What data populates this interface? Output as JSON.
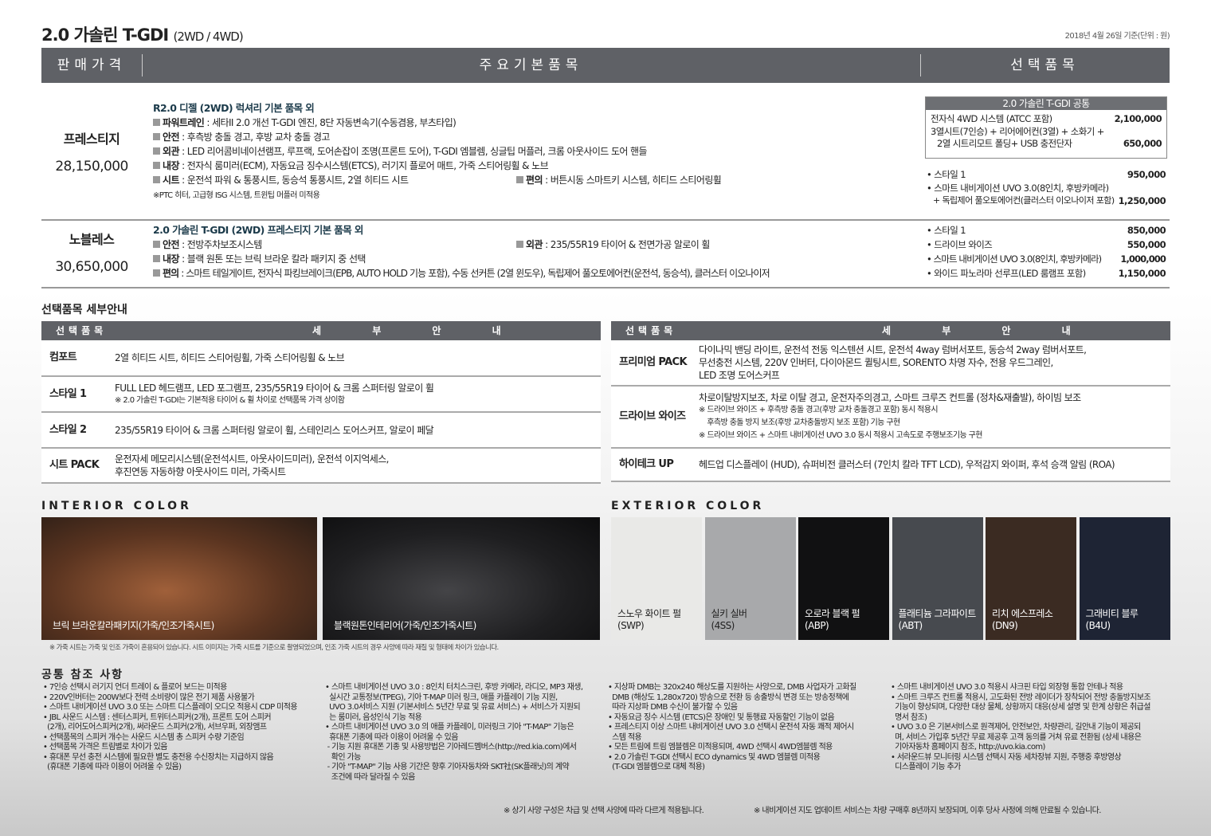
{
  "title": {
    "main": "2.0 가솔린 T-GDI",
    "sub": "(2WD / 4WD)",
    "date_unit": "2018년 4월 26일 기준(단위 : 원)"
  },
  "header": {
    "price": "판매가격",
    "basic": "주요기본품목",
    "options": "선택품목"
  },
  "trims": [
    {
      "name": "프레스티지",
      "price": "28,150,000",
      "base": "R2.0 디젤 (2WD) 럭셔리 기본 품목 외",
      "items": [
        {
          "k": "파워트레인",
          "v": " : 세타II 2.0 개선 T-GDI 엔진, 8단 자동변속기(수동겸용, 부츠타입)"
        },
        {
          "k": "안전",
          "v": " : 후측방 충돌 경고, 후방 교차 충돌 경고"
        },
        {
          "k": "외관",
          "v": " : LED 리어콤비네이션램프, 루프랙, 도어손잡이 조명(프론트 도어), T-GDI 엠블렘, 싱글팁 머플러, 크롬 아웃사이드 도어 핸들"
        },
        {
          "k": "내장",
          "v": " : 전자식 룸미러(ECM), 자동요금 징수시스템(ETCS), 러기지 플로어 매트, 가죽 스티어링휠 & 노브"
        },
        {
          "k": "시트",
          "v": " : 운전석 파워 & 통풍시트, 동승석 통풍시트, 2열 히티드 시트"
        },
        {
          "k": "편의",
          "v": " : 버튼시동 스마트키 시스템, 히티드 스티어링휠"
        }
      ],
      "note": "※PTC 히터, 고급형 ISG 시스템, 트윈팁 머플러 미적용",
      "options": [
        {
          "label": "스타일 1",
          "price": "950,000"
        },
        {
          "label": "스마트 내비게이션 UVO 3.0(8인치, 후방카메라)",
          "label2": "+ 독립제어 풀오토에어컨(클러스터 이오나이저 포함)",
          "price": "1,250,000"
        }
      ]
    },
    {
      "name": "노블레스",
      "price": "30,650,000",
      "base": "2.0 가솔린 T-GDI (2WD) 프레스티지 기본 품목 외",
      "items": [
        {
          "k": "안전",
          "v": " : 전방주차보조시스템"
        },
        {
          "k": "외관",
          "v": " : 235/55R19 타이어 & 전면가공 알로이 휠"
        },
        {
          "k": "내장",
          "v": " : 블랙 원톤 또는 브릭 브라운 칼라 패키지 중 선택"
        },
        {
          "k": "편의",
          "v": " : 스마트 테일게이트, 전자식 파킹브레이크(EPB, AUTO HOLD 기능 포함), 수동 선커튼 (2열 윈도우), 독립제어 풀오토에어컨(운전석, 동승석), 클러스터 이오나이저"
        }
      ],
      "options": [
        {
          "label": "스타일 1",
          "price": "850,000"
        },
        {
          "label": "드라이브 와이즈",
          "price": "550,000"
        },
        {
          "label": "스마트 내비게이션 UVO 3.0(8인치, 후방카메라)",
          "price": "1,000,000"
        },
        {
          "label": "와이드 파노라마 선루프(LED 룸램프 포함)",
          "price": "1,150,000"
        }
      ]
    }
  ],
  "common_options": {
    "title": "2.0 가솔린 T-GDI 공통",
    "items": [
      {
        "label": "전자식 4WD 시스템 (ATCC 포함)",
        "price": "2,100,000"
      },
      {
        "label": "3열시트(7인승) + 리어에어컨(3열) + 소화기 +",
        "label2": "2열 시트리모트 폴딩+ USB 충전단자",
        "price": "650,000"
      }
    ]
  },
  "option_detail": {
    "title": "선택품목 세부안내",
    "col1": "선택품목",
    "col2": "세 부 안 내",
    "left": [
      {
        "k": "컴포트",
        "v": [
          "2열 히티드 시트, 히티드 스티어링휠, 가죽 스티어링휠 & 노브"
        ]
      },
      {
        "k": "스타일 1",
        "v": [
          "FULL LED 헤드램프, LED 포그램프, 235/55R19 타이어 & 크롬 스퍼터링 알로이 휠"
        ],
        "n": [
          "※ 2.0 가솔린 T-GDI는 기본적용 타이어 & 휠 차이로 선택품목 가격 상이함"
        ]
      },
      {
        "k": "스타일 2",
        "v": [
          "235/55R19 타이어 & 크롬 스퍼터링 알로이 휠, 스테인리스 도어스커프, 알로이 페달"
        ]
      },
      {
        "k": "시트 PACK",
        "v": [
          "운전자세 메모리시스템(운전석시트, 아웃사이드미러), 운전석 이지억세스,",
          "후진연동 자동하향 아웃사이드 미러, 가죽시트"
        ]
      }
    ],
    "right": [
      {
        "k": "프리미엄 PACK",
        "v": [
          "다이나믹 밴딩 라이트, 운전석 전동 익스텐션 시트, 운전석 4way 럼버서포트, 동승석 2way 럼버서포트,",
          "무선충전 시스템, 220V 인버터, 다이아몬드 퀼팅시트, SORENTO 차명 자수, 전용 우드그레인,",
          "LED 조명 도어스커프"
        ]
      },
      {
        "k": "드라이브 와이즈",
        "v": [
          "차로이탈방지보조, 차로 이탈 경고, 운전자주의경고, 스마트 크루즈 컨트롤 (정차&재출발), 하이빔 보조"
        ],
        "n": [
          "※ 드라이브 와이즈 + 후측방 충돌 경고(후방 교차 충돌경고 포함) 동시 적용시",
          "    후측방 충돌 방지 보조(후방 교차충돌방지 보조 포함) 기능 구현",
          "※ 드라이브 와이즈 + 스마트 내비게이션 UVO 3.0 동시 적용시 고속도로 주행보조기능 구현"
        ]
      },
      {
        "k": "하이테크 UP",
        "v": [
          "헤드업 디스플레이 (HUD), 슈퍼비전 클러스터 (7인치 칼라 TFT LCD), 우적감지 와이퍼, 후석 승객 알림 (ROA)"
        ]
      }
    ]
  },
  "interior": {
    "title": "INTERIOR COLOR",
    "items": [
      {
        "label": "브릭 브라운칼라패키지(가죽/인조가죽시트)",
        "color": "#7a4a2e"
      },
      {
        "label": "블랙원톤인테리어(가죽/인조가죽시트)",
        "color": "#2a2a2c"
      }
    ],
    "note": "※ 가죽 시트는 가죽 및 인조 가죽이 혼용되어 있습니다. 시트 이미지는 가죽 시트를 기준으로 촬영되었으며, 인조 가죽 시트의 경우 사양에 따라 재질 및 형태에 차이가 있습니다."
  },
  "exterior": {
    "title": "EXTERIOR COLOR",
    "items": [
      {
        "name": "스노우 화이트 펄",
        "code": "(SWP)",
        "color": "#e9e9e7",
        "text": "#222"
      },
      {
        "name": "실키 실버",
        "code": "(4SS)",
        "color": "#a8a9ab",
        "text": "#222"
      },
      {
        "name": "오로라 블랙 펄",
        "code": "(ABP)",
        "color": "#111112",
        "text": "#fff"
      },
      {
        "name": "플래티늄 그라파이트",
        "code": "(ABT)",
        "color": "#474a4f",
        "text": "#fff"
      },
      {
        "name": "리치 에스프레소",
        "code": "(DN9)",
        "color": "#3b2b22",
        "text": "#fff"
      },
      {
        "name": "그래비티 블루",
        "code": "(B4U)",
        "color": "#1e2434",
        "text": "#fff"
      }
    ]
  },
  "notes": {
    "title": "공통 참조 사항",
    "columns": [
      [
        "• 7인승 선택시 러기지 언더 트레이 & 플로어 보드는 미적용",
        "• 220V인버터는 200W보다 전력 소비량이 많은 전기 제품 사용불가",
        "• 스마트 내비게이션 UVO 3.0 또는 스마트 디스플레이 오디오 적용시 CDP 미적용",
        "• JBL 사운드 시스템 : 센터스피커, 트위터스피커(2개), 프론트 도어 스피커\n  (2개), 리어도어스피커(2개), 써라운드 스피커(2개), 서브우퍼, 외장앰프",
        "• 선택품목의 스피커 개수는 사운드 시스템 총 스피커 수량 기준임",
        "• 선택품목 가격은 트림별로 차이가 있음",
        "• 휴대폰 무선 충전 시스템에 필요한 별도 충전용 수신장치는 지급하지 않음\n  (휴대폰 기종에 따라 이용이 어려울 수 있음)"
      ],
      [
        "• 스마트 내비게이션 UVO 3.0 : 8인치 터치스크린, 후방 카메라, 라디오, MP3 재생,\n  실시간 교통정보(TPEG), 기아 T-MAP 미러 링크, 애플 카플레이 기능 지원,\n  UVO 3.0서비스 지원 (기본서비스 5년간 무료 및 유료 서비스) + 서비스가 지원되\n  는 룸미러, 음성인식 기능 적용",
        "• 스마트 내비게이션 UVO 3.0 의 애플 카플레이, 미러링크 기아 \"T-MAP\" 기능은\n  휴대폰 기종에 따라 이용이 어려울 수 있음",
        " - 기능 지원 휴대폰 기종 및 사용방법은 기아레드멤버스(http://red.kia.com)에서\n   확인 가능",
        " - 기아 \"T-MAP\" 기능 사용 기간은 향후 기아자동차와 SKT社(SK플래닛)의 계약\n   조건에 따라 달라질 수 있음"
      ],
      [
        "• 지상파 DMB는 320x240 해상도를 지원하는 사양으로, DMB 사업자가 고화질\n  DMB (해상도 1,280x720) 방송으로 전환 등 송출방식 변경 또는 방송정책에\n  따라 지상파 DMB 수신이 불가할 수 있음",
        "• 자동요금 징수 시스템 (ETCS)은 장애인 및 통행료 자동할인 기능이 없음",
        "• 프레스티지 이상 스마트 내비게이션 UVO 3.0 선택시 운전석 자동 쾌적 제어시\n  스템 적용",
        "• 모든 트림에 트림 엠블렘은 미적용되며, 4WD 선택시 4WD엠블렘 적용",
        "• 2.0 가솔린 T-GDI 선택시 ECO dynamics 및 4WD 엠블렘 미적용\n  (T-GDI 엠블렘으로 대체 적용)"
      ],
      [
        "• 스마트 내비게이션 UVO 3.0 적용시 샤크핀 타입 외장형 통합 안테나 적용",
        "• 스마트 크루즈 컨트롤 적용시, 고도화된 전방 레이더가 장착되어 전방 충돌방지보조\n  기능이 향상되며, 다양한 대상 물체, 상황까지 대응(상세 설명 및 한계 상황은 취급설\n  명서 참조)",
        "• UVO 3.0 은 기본서비스로 원격제어, 안전보안, 차량관리, 길안내 기능이 제공되\n  며, 서비스 가입후 5년간 무료 제공후 고객 동의를 거쳐 유료 전환됨 (상세 내용은\n  기아자동차 홈페이지 참조, http://uvo.kia.com)",
        "• 서라운드뷰 모니터링 시스템 선택시 자동 세차장뷰 지원, 주행중 후방영상\n  디스플레이 기능 추가"
      ]
    ]
  },
  "footer": {
    "left": "※ 상기 사양 구성은 차급 및 선택 사양에 따라 다르게 적용됩니다.",
    "right": "※ 내비게이션 지도 업데이트 서비스는 차량 구매후 8년까지 보장되며, 이후 당사 사정에 의해 만료될 수 있습니다."
  }
}
